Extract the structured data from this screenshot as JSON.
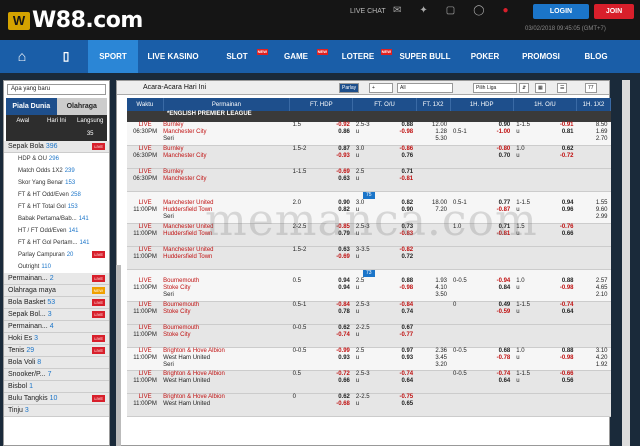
{
  "brand": {
    "name": "W88.com"
  },
  "header": {
    "live_chat": "LIVE CHAT",
    "login": "LOGIN",
    "join": "JOIN",
    "datetime": "03/02/2018 09:45:05 (GMT+7)"
  },
  "nav": [
    {
      "label": "SPORT"
    },
    {
      "label": "LIVE KASINO"
    },
    {
      "label": "SLOT",
      "new": "NEW"
    },
    {
      "label": "GAME",
      "new": "NEW"
    },
    {
      "label": "LOTERE",
      "new": "NEW"
    },
    {
      "label": "SUPER BULL"
    },
    {
      "label": "POKER"
    },
    {
      "label": "PROMOSI"
    },
    {
      "label": "BLOG"
    }
  ],
  "sidebar": {
    "select": "Apa yang baru",
    "tabs": [
      "Piala Dunia",
      "Olahraga"
    ],
    "subtabs": [
      "Awal",
      "Hari Ini",
      "Langsung 35"
    ],
    "items": [
      {
        "label": "Sepak Bola",
        "n": "396",
        "badge": "LIVE",
        "type": "main"
      },
      {
        "label": "HDP & OU",
        "n": "296",
        "type": "sub"
      },
      {
        "label": "Match Odds 1X2",
        "n": "239",
        "type": "sub"
      },
      {
        "label": "Skor Yang Benar",
        "n": "153",
        "type": "sub"
      },
      {
        "label": "FT & HT Odd/Even",
        "n": "258",
        "type": "sub"
      },
      {
        "label": "FT & HT Total Gol",
        "n": "153",
        "type": "sub"
      },
      {
        "label": "Babak Pertama/Bab...",
        "n": "141",
        "type": "sub"
      },
      {
        "label": "HT / FT Odd/Even",
        "n": "141",
        "type": "sub"
      },
      {
        "label": "FT & HT Gol Pertam...",
        "n": "141",
        "type": "sub"
      },
      {
        "label": "Parlay Campuran",
        "n": "20",
        "badge": "LIVE",
        "type": "sub"
      },
      {
        "label": "Outright",
        "n": "110",
        "type": "sub"
      },
      {
        "label": "Permainan...",
        "n": "2",
        "badge": "LIVE",
        "type": "main"
      },
      {
        "label": "Olahraga maya",
        "n": "",
        "badge": "NEW",
        "type": "main"
      },
      {
        "label": "Bola Basket",
        "n": "53",
        "badge": "LIVE",
        "type": "main"
      },
      {
        "label": "Sepak Bol...",
        "n": "3",
        "badge": "LIVE",
        "type": "main"
      },
      {
        "label": "Permainan...",
        "n": "4",
        "type": "main"
      },
      {
        "label": "Hoki Es",
        "n": "3",
        "badge": "LIVE",
        "type": "main"
      },
      {
        "label": "Tenis",
        "n": "29",
        "badge": "LIVE",
        "type": "main"
      },
      {
        "label": "Bola Voli",
        "n": "8",
        "type": "main"
      },
      {
        "label": "Snooker/P...",
        "n": "7",
        "type": "main"
      },
      {
        "label": "Bisbol",
        "n": "1",
        "type": "main"
      },
      {
        "label": "Bulu Tangkis",
        "n": "10",
        "badge": "LIVE",
        "type": "main"
      },
      {
        "label": "Tinju",
        "n": "3",
        "type": "main"
      }
    ]
  },
  "main": {
    "title": "Acara-Acara Hari Ini",
    "parlay": "Parlay",
    "filter": "All",
    "liga": "Pilih Liga",
    "count": "77",
    "cols": [
      "Waktu",
      "Permainan",
      "FT. HDP",
      "FT. O/U",
      "FT. 1X2",
      "1H. HDP",
      "1H. O/U",
      "1H. 1X2"
    ],
    "league": "*ENGLISH PREMIER LEAGUE",
    "rows": [
      {
        "time": [
          "LIVE",
          "06:30PM"
        ],
        "teams": [
          "Burnley",
          "Manchester City",
          "Seri"
        ],
        "hdp": [
          "1.5",
          ""
        ],
        "hdpo": [
          "-0.92",
          "0.86"
        ],
        "ou": [
          "2.5-3",
          "u"
        ],
        "ouo": [
          "0.88",
          "-0.98"
        ],
        "x12": [
          "12.00",
          "1.28",
          "5.30"
        ],
        "hhdp": [
          "",
          "0.5-1"
        ],
        "hhdpo": [
          "0.90",
          "-1.00"
        ],
        "hou": [
          "1-1.5",
          "u"
        ],
        "houo": [
          "-0.91",
          "0.81"
        ],
        "hx12": [
          "8.50",
          "1.69",
          "2.70"
        ],
        "cls": "r1"
      },
      {
        "time": [
          "LIVE",
          "06:30PM"
        ],
        "teams": [
          "Burnley",
          "Manchester City"
        ],
        "hdp": [
          "1.5-2",
          ""
        ],
        "hdpo": [
          "0.87",
          "-0.93"
        ],
        "ou": [
          "3.0",
          "u"
        ],
        "ouo": [
          "-0.86",
          "0.76"
        ],
        "x12": [
          "",
          "",
          ""
        ],
        "hhdp": [
          "",
          ""
        ],
        "hhdpo": [
          "-0.80",
          "0.70"
        ],
        "hou": [
          "1.0",
          "u"
        ],
        "houo": [
          "0.62",
          "-0.72"
        ],
        "hx12": [
          "",
          "",
          ""
        ],
        "cls": "r2"
      },
      {
        "time": [
          "LIVE",
          "06:30PM"
        ],
        "teams": [
          "Burnley",
          "Manchester City"
        ],
        "hdp": [
          "1-1.5",
          ""
        ],
        "hdpo": [
          "-0.69",
          "0.63"
        ],
        "ou": [
          "2.5",
          "u"
        ],
        "ouo": [
          "0.71",
          "-0.81"
        ],
        "x12": [
          "",
          "",
          ""
        ],
        "hhdp": [
          "",
          ""
        ],
        "hhdpo": [
          "",
          ""
        ],
        "hou": [
          "",
          ""
        ],
        "houo": [
          "",
          ""
        ],
        "hx12": [
          "",
          "",
          ""
        ],
        "cls": "r2",
        "more": "75"
      },
      {
        "time": [
          "LIVE",
          "11:00PM"
        ],
        "teams": [
          "Manchester United",
          "Huddersfield Town",
          "Seri"
        ],
        "hdp": [
          "2.0",
          ""
        ],
        "hdpo": [
          "0.90",
          "0.82"
        ],
        "ou": [
          "3.0",
          "u"
        ],
        "ouo": [
          "0.82",
          "0.90"
        ],
        "x12": [
          "",
          "18.00",
          "7.20"
        ],
        "hhdp": [
          "0.5-1",
          ""
        ],
        "hhdpo": [
          "0.77",
          "-0.87"
        ],
        "hou": [
          "1-1.5",
          "u"
        ],
        "houo": [
          "0.94",
          "0.96"
        ],
        "hx12": [
          "1.55",
          "9.60",
          "2.99"
        ],
        "cls": "r1"
      },
      {
        "time": [
          "LIVE",
          "11:00PM"
        ],
        "teams": [
          "Manchester United",
          "Huddersfield Town"
        ],
        "hdp": [
          "2-2.5",
          ""
        ],
        "hdpo": [
          "-0.85",
          "0.79"
        ],
        "ou": [
          "2.5-3",
          "u"
        ],
        "ouo": [
          "0.73",
          "-0.83"
        ],
        "x12": [
          "",
          "",
          ""
        ],
        "hhdp": [
          "1.0",
          ""
        ],
        "hhdpo": [
          "0.71",
          "-0.81"
        ],
        "hou": [
          "1.5",
          "u"
        ],
        "houo": [
          "-0.76",
          "0.66"
        ],
        "hx12": [
          "",
          "",
          ""
        ],
        "cls": "r2"
      },
      {
        "time": [
          "LIVE",
          "11:00PM"
        ],
        "teams": [
          "Manchester United",
          "Huddersfield Town"
        ],
        "hdp": [
          "1.5-2",
          ""
        ],
        "hdpo": [
          "0.63",
          "-0.69"
        ],
        "ou": [
          "3-3.5",
          "u"
        ],
        "ouo": [
          "-0.82",
          "0.72"
        ],
        "x12": [
          "",
          "",
          ""
        ],
        "hhdp": [
          "",
          ""
        ],
        "hhdpo": [
          "",
          ""
        ],
        "hou": [
          "",
          ""
        ],
        "houo": [
          "",
          ""
        ],
        "hx12": [
          "",
          "",
          ""
        ],
        "cls": "r2",
        "more": "73"
      },
      {
        "time": [
          "LIVE",
          "11:00PM"
        ],
        "teams": [
          "Bournemouth",
          "Stoke City",
          "Seri"
        ],
        "hdp": [
          "0.5",
          ""
        ],
        "hdpo": [
          "0.94",
          "0.94"
        ],
        "ou": [
          "2.5",
          "u"
        ],
        "ouo": [
          "0.88",
          "-0.98"
        ],
        "x12": [
          "1.93",
          "4.10",
          "3.50"
        ],
        "hhdp": [
          "0-0.5",
          ""
        ],
        "hhdpo": [
          "-0.94",
          "0.84"
        ],
        "hou": [
          "1.0",
          "u"
        ],
        "houo": [
          "0.88",
          "-0.98"
        ],
        "hx12": [
          "2.57",
          "4.65",
          "2.10"
        ],
        "cls": "r1"
      },
      {
        "time": [
          "LIVE",
          "11:00PM"
        ],
        "teams": [
          "Bournemouth",
          "Stoke City"
        ],
        "hdp": [
          "0.5-1",
          ""
        ],
        "hdpo": [
          "-0.84",
          "0.78"
        ],
        "ou": [
          "2.5-3",
          "u"
        ],
        "ouo": [
          "-0.84",
          "0.74"
        ],
        "x12": [
          "",
          "",
          ""
        ],
        "hhdp": [
          "0",
          ""
        ],
        "hhdpo": [
          "0.49",
          "-0.59"
        ],
        "hou": [
          "1-1.5",
          "u"
        ],
        "houo": [
          "-0.74",
          "0.64"
        ],
        "hx12": [
          "",
          "",
          ""
        ],
        "cls": "r2"
      },
      {
        "time": [
          "LIVE",
          "11:00PM"
        ],
        "teams": [
          "Bournemouth",
          "Stoke City"
        ],
        "hdp": [
          "0-0.5",
          ""
        ],
        "hdpo": [
          "0.62",
          "-0.74"
        ],
        "ou": [
          "2-2.5",
          "u"
        ],
        "ouo": [
          "0.67",
          "-0.77"
        ],
        "x12": [
          "",
          "",
          ""
        ],
        "hhdp": [
          "",
          ""
        ],
        "hhdpo": [
          "",
          ""
        ],
        "hou": [
          "",
          ""
        ],
        "houo": [
          "",
          ""
        ],
        "hx12": [
          "",
          "",
          ""
        ],
        "cls": "r2"
      },
      {
        "time": [
          "LIVE",
          "11:00PM"
        ],
        "teams": [
          "Brighton & Hove Albion",
          "West Ham United",
          "Seri"
        ],
        "hdp": [
          "0-0.5",
          ""
        ],
        "hdpo": [
          "-0.99",
          "0.93"
        ],
        "ou": [
          "2.5",
          "u"
        ],
        "ouo": [
          "0.97",
          "0.93"
        ],
        "x12": [
          "2.36",
          "3.45",
          "3.20"
        ],
        "hhdp": [
          "0-0.5",
          ""
        ],
        "hhdpo": [
          "0.68",
          "-0.78"
        ],
        "hou": [
          "1.0",
          "u"
        ],
        "houo": [
          "0.88",
          "-0.98"
        ],
        "hx12": [
          "3.10",
          "4.20",
          "1.92"
        ],
        "cls": "r1"
      },
      {
        "time": [
          "LIVE",
          "11:00PM"
        ],
        "teams": [
          "Brighton & Hove Albion",
          "West Ham United"
        ],
        "hdp": [
          "0.5",
          ""
        ],
        "hdpo": [
          "-0.72",
          "0.66"
        ],
        "ou": [
          "2.5-3",
          "u"
        ],
        "ouo": [
          "-0.74",
          "0.64"
        ],
        "x12": [
          "",
          "",
          ""
        ],
        "hhdp": [
          "0-0.5",
          ""
        ],
        "hhdpo": [
          "-0.74",
          "0.64"
        ],
        "hou": [
          "1-1.5",
          "u"
        ],
        "houo": [
          "-0.66",
          "0.56"
        ],
        "hx12": [
          "",
          "",
          ""
        ],
        "cls": "r2"
      },
      {
        "time": [
          "LIVE",
          "11:00PM"
        ],
        "teams": [
          "Brighton & Hove Albion",
          "West Ham United"
        ],
        "hdp": [
          "0",
          ""
        ],
        "hdpo": [
          "0.62",
          "-0.68"
        ],
        "ou": [
          "2-2.5",
          "u"
        ],
        "ouo": [
          "-0.75",
          "0.65"
        ],
        "x12": [
          "",
          "",
          ""
        ],
        "hhdp": [
          "",
          ""
        ],
        "hhdpo": [
          "",
          ""
        ],
        "hou": [
          "",
          ""
        ],
        "houo": [
          "",
          ""
        ],
        "hx12": [
          "",
          "",
          ""
        ],
        "cls": "r2"
      }
    ]
  },
  "watermark": "memanca.com"
}
